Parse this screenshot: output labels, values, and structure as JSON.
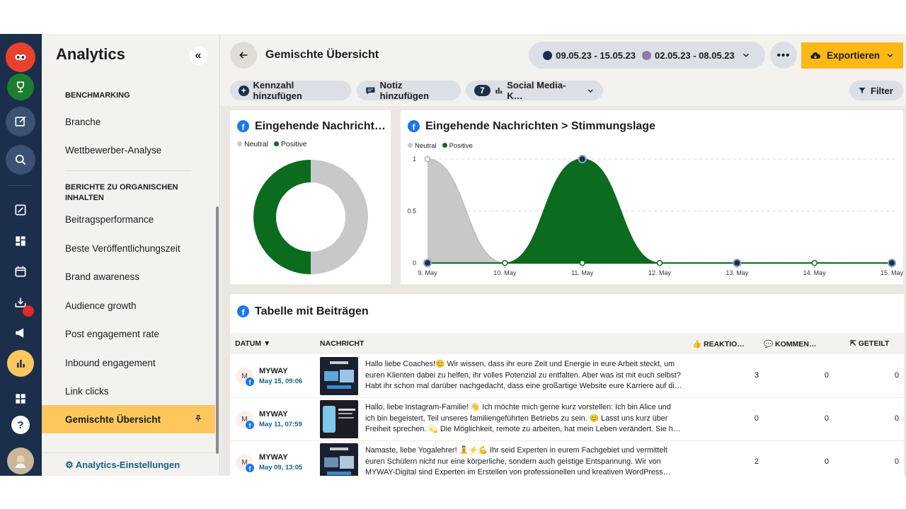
{
  "sidebar": {
    "title": "Analytics",
    "collapse": "«",
    "section_benchmarking": "BENCHMARKING",
    "items_benchmarking": [
      "Branche",
      "Wettbewerber-Analyse"
    ],
    "section_organic": "BERICHTE ZU ORGANISCHEN INHALTEN",
    "items_organic": [
      "Beitragsperformance",
      "Beste Veröffentlichungszeit",
      "Brand awareness",
      "Audience growth",
      "Post engagement rate",
      "Inbound engagement",
      "Link clicks",
      "Gemischte Übersicht"
    ],
    "active_item": "Gemischte Übersicht",
    "settings": "⚙ Analytics-Einstellungen"
  },
  "header": {
    "title": "Gemischte Übersicht",
    "date_current": "09.05.23 - 15.05.23",
    "date_compare": "02.05.23 - 08.05.23",
    "more": "•••",
    "export": "Exportieren"
  },
  "toolbar": {
    "add_metric": "Kennzahl hinzufügen",
    "add_note": "Notiz hinzufügen",
    "network_count": "7",
    "network_label": "Social Media-K…",
    "filter": "Filter"
  },
  "colors": {
    "neutral": "#c8c8c8",
    "positive": "#0b6b1e",
    "accent": "#fdb816",
    "rail": "#1b2e4b",
    "current_dot": "#1b2e4b",
    "compare_dot": "#8e7bab"
  },
  "donut_card": {
    "title": "Eingehende Nachricht…",
    "legend": [
      "Neutral",
      "Positive"
    ]
  },
  "line_card": {
    "title": "Eingehende Nachrichten > Stimmungslage",
    "legend": [
      "Neutral",
      "Positive"
    ]
  },
  "chart_data": [
    {
      "type": "pie",
      "title": "Eingehende Nachricht…",
      "categories": [
        "Neutral",
        "Positive"
      ],
      "values": [
        1,
        1
      ]
    },
    {
      "type": "area",
      "title": "Eingehende Nachrichten > Stimmungslage",
      "categories": [
        "9. May",
        "10. May",
        "11. May",
        "12. May",
        "13. May",
        "14. May",
        "15. May"
      ],
      "series": [
        {
          "name": "Neutral",
          "values": [
            1,
            0,
            0,
            0,
            0,
            0,
            0
          ]
        },
        {
          "name": "Positive",
          "values": [
            0,
            0,
            1,
            0,
            0,
            0,
            0
          ]
        }
      ],
      "ylim": [
        0,
        1
      ],
      "yticks": [
        "0",
        "0.5",
        "1"
      ]
    }
  ],
  "table": {
    "title": "Tabelle mit Beiträgen",
    "columns": [
      "DATUM ▼",
      "NACHRICHT",
      "REAKTIO…",
      "KOMMEN…",
      "GETEILT"
    ],
    "rows": [
      {
        "account": "MYWAY",
        "date": "May 15, 09:06",
        "message": [
          "Hallo liebe Coaches!😊 Wir wissen, dass ihr eure Zeit und Energie in eure Arbeit steckt, um",
          "euren Klienten dabei zu helfen, ihr volles Potenzial zu entfalten. Aber was ist mit euch selbst?",
          "Habt ihr schon mal darüber nachgedacht, dass eine großartige Website eure Karriere auf di…"
        ],
        "reactions": "3",
        "comments": "0",
        "shares": "0"
      },
      {
        "account": "MYWAY",
        "date": "May 11, 07:59",
        "message": [
          "Hallo, liebe Instagram-Familie! 👋 Ich möchte mich gerne kurz vorstellen: Ich bin Alice und",
          "ich bin begeistert, Teil unseres familiengeführten Betriebs zu sein. 😊 Lasst uns kurz über",
          "Freiheit sprechen. 💫 Die Möglichkeit, remote zu arbeiten, hat mein Leben verändert. Sie h…"
        ],
        "reactions": "0",
        "comments": "0",
        "shares": "0"
      },
      {
        "account": "MYWAY",
        "date": "May 09, 13:05",
        "message": [
          "Namaste, liebe Yogalehrer! 🧘⚡💪 Ihr seid Experten in eurem Fachgebiet und vermittelt",
          "euren Schülern nicht nur eine körperliche, sondern auch geistige Entspannung. Wir von",
          "MYWAY-Digital sind Experten im Erstellen von professionellen und kreativen WordPress…"
        ],
        "reactions": "2",
        "comments": "0",
        "shares": "0"
      }
    ]
  }
}
